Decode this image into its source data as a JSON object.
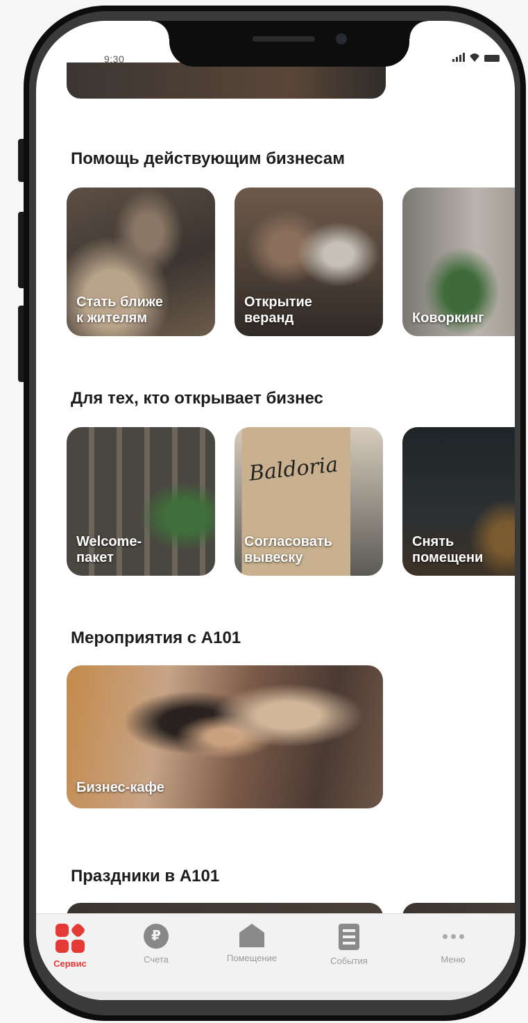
{
  "status_bar": {
    "time": "9:30"
  },
  "sections": [
    {
      "title": "Помощь действующим бизнесам",
      "cards": [
        {
          "label": "Стать ближе\nк жителям"
        },
        {
          "label": "Открытие\nверанд"
        },
        {
          "label": "Коворкинг"
        }
      ]
    },
    {
      "title": "Для тех, кто открывает бизнес",
      "cards": [
        {
          "label": "Welcome-\nпакет"
        },
        {
          "label": "Согласовать\nвывеску"
        },
        {
          "label": "Снять\nпомещени"
        }
      ]
    },
    {
      "title": "Мероприятия с А101",
      "cards": [
        {
          "label": "Бизнес-кафе"
        }
      ]
    },
    {
      "title": "Праздники в А101",
      "cards": []
    }
  ],
  "sign_text": "Baldoria",
  "tabbar": {
    "tabs": [
      {
        "label": "Сервис",
        "icon": "services-grid-icon",
        "active": true
      },
      {
        "label": "Счета",
        "icon": "ruble-coin-icon",
        "active": false
      },
      {
        "label": "Помещение",
        "icon": "house-icon",
        "active": false
      },
      {
        "label": "События",
        "icon": "document-list-icon",
        "active": false
      },
      {
        "label": "Меню",
        "icon": "more-dots-icon",
        "active": false
      }
    ]
  },
  "colors": {
    "accent": "#e53935",
    "inactive": "#9a9a9a"
  }
}
